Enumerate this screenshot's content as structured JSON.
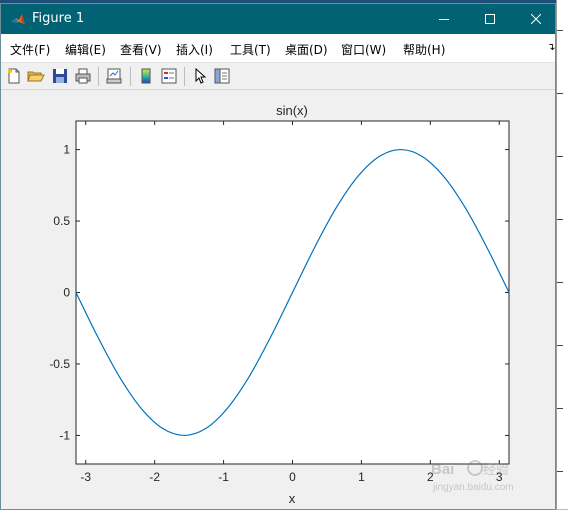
{
  "window": {
    "title": "Figure 1",
    "controls": {
      "minimize": "minimize-icon",
      "maximize": "maximize-icon",
      "close": "close-icon"
    }
  },
  "menu": {
    "items": [
      "文件(F)",
      "编辑(E)",
      "查看(V)",
      "插入(I)",
      "工具(T)",
      "桌面(D)",
      "窗口(W)",
      "帮助(H)"
    ]
  },
  "toolbar": {
    "icons": [
      "new-figure-icon",
      "open-file-icon",
      "save-icon",
      "print-icon",
      "link-plot-icon",
      "colorbar-icon",
      "legend-icon",
      "edit-plot-arrow-icon",
      "property-inspector-icon"
    ]
  },
  "watermark": "Baidu 经验 jingyan.baidu.com",
  "chart_data": {
    "type": "line",
    "title": "sin(x)",
    "xlabel": "x",
    "ylabel": "",
    "xlim": [
      -3.1416,
      3.1416
    ],
    "ylim": [
      -1.2,
      1.2
    ],
    "xticks": [
      -3,
      -2,
      -1,
      0,
      1,
      2,
      3
    ],
    "yticks": [
      -1,
      -0.5,
      0,
      0.5,
      1
    ],
    "grid": false,
    "color": "#0072bd",
    "series": [
      {
        "x": [
          -3.1416,
          -2.8274,
          -2.5133,
          -2.1991,
          -1.885,
          -1.5708,
          -1.2566,
          -0.9425,
          -0.6283,
          -0.3142,
          0,
          0.3142,
          0.6283,
          0.9425,
          1.2566,
          1.5708,
          1.885,
          2.1991,
          2.5133,
          2.8274,
          3.1416
        ],
        "y": [
          0,
          -0.309,
          -0.588,
          -0.809,
          -0.951,
          -1,
          -0.951,
          -0.809,
          -0.588,
          -0.309,
          0,
          0.309,
          0.588,
          0.809,
          0.951,
          1,
          0.951,
          0.809,
          0.588,
          0.309,
          0
        ]
      }
    ]
  }
}
